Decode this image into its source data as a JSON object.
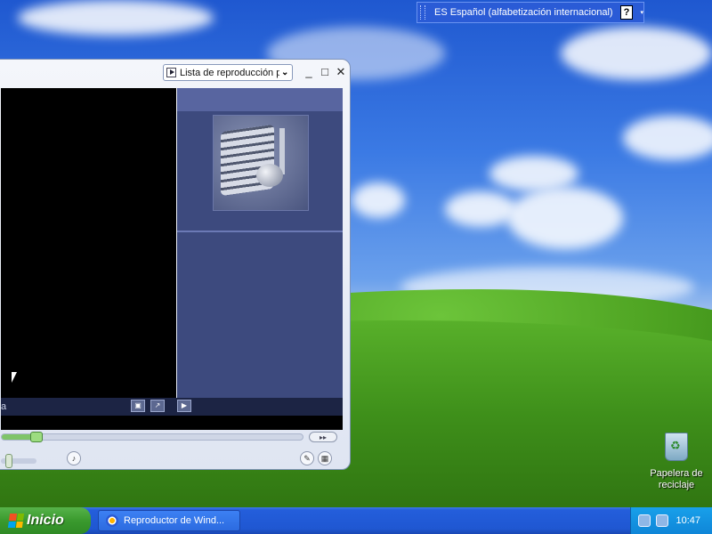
{
  "language_bar": {
    "text": "ES Español (alfabetización internacional)",
    "help_glyph": "?",
    "options_glyph": "▾"
  },
  "media_player": {
    "playlist_dropdown": "Lista de reproducción p",
    "status_text": "a",
    "fast_forward_glyph": "▸▸",
    "buttons": {
      "minimize": "_",
      "maximize": "□",
      "close": "✕"
    },
    "seek_position_percent": 10,
    "volume_percent": 15
  },
  "desktop": {
    "recycle_bin_label": "Papelera de reciclaje"
  },
  "taskbar": {
    "start_label": "Inicio",
    "task_button_label": "Reproductor de Wind...",
    "clock": "10:47"
  },
  "colors": {
    "taskbar": "#245edb",
    "start_button": "#3a9a2e",
    "tray": "#0f86d8",
    "playlist_pane": "#3d4a7e"
  }
}
